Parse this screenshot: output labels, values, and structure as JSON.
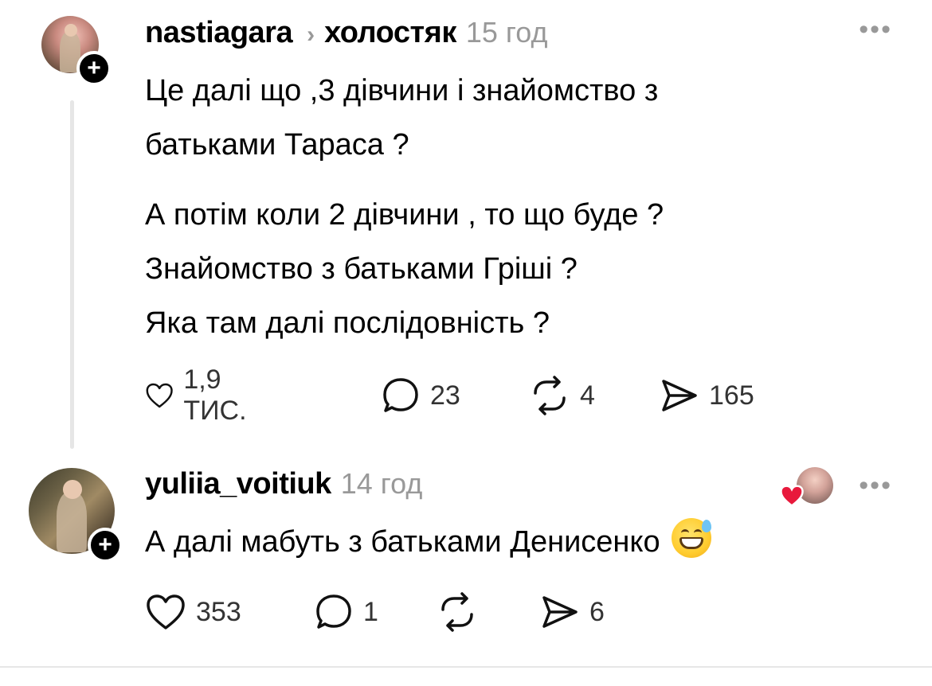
{
  "post1": {
    "username": "nastiagara",
    "chevron": "›",
    "community": "холостяк",
    "time": "15 год",
    "more": "•••",
    "follow": "+",
    "lines": [
      "Це далі що ,3 дівчини і знайомство з",
      "батьками Тараса ?",
      "А потім коли 2 дівчини , то що буде ?",
      "Знайомство з батьками Гріші ?",
      "Яка там далі послідовність ?"
    ],
    "likes": "1,9 ТИС.",
    "replies": "23",
    "reposts": "4",
    "shares": "165"
  },
  "post2": {
    "username": "yuliia_voitiuk",
    "time": "14 год",
    "more": "•••",
    "follow": "+",
    "text": "А далі мабуть з батьками Денисенко",
    "emoji": "grinning-face-with-sweat",
    "likes": "353",
    "replies": "1",
    "reposts": "",
    "shares": "6"
  },
  "colors": {
    "heart": "#e8193c",
    "muted": "#999999",
    "text": "#000000"
  }
}
